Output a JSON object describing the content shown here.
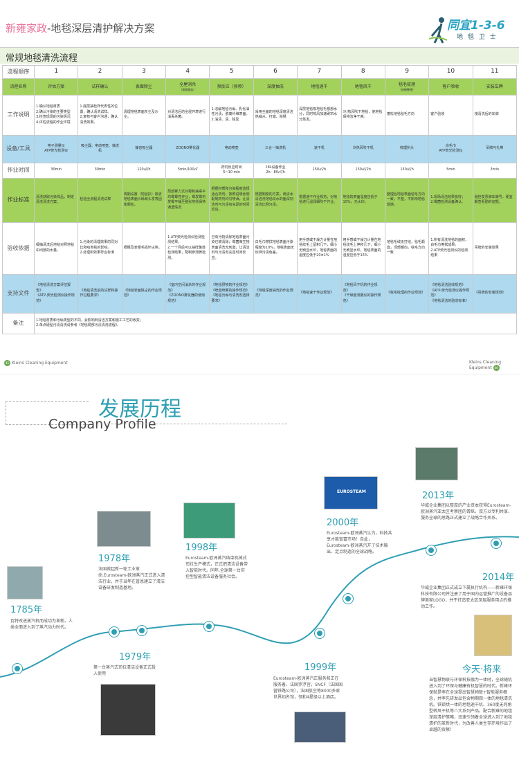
{
  "header": {
    "brand": "新雍家政",
    "title": "-地毯深层清护解决方案",
    "logo_main": "同宜1-3-6",
    "logo_sub": "地 毯 卫 士"
  },
  "section_title": "常规地毯清洗流程",
  "table": {
    "row_heads": [
      "流程顺序",
      "流程名称",
      "工作说明",
      "设备/工具",
      "作业时间",
      "作业标准",
      "验收依据",
      "支持文件",
      "备注"
    ],
    "numbers": [
      "1",
      "2",
      "3",
      "4",
      "5",
      "6",
      "7",
      "8",
      "9",
      "10",
      "11"
    ],
    "names": [
      "评估方案",
      "试样确认",
      "表面除尘",
      "全屋消杀",
      "预反应（预喷）",
      "深度抽洗",
      "地毯速干",
      "地毯风干",
      "毯毛梳理",
      "客户验收",
      "安装车牌"
    ],
    "name_subs": [
      "",
      "",
      "",
      "（地毯服务）",
      "",
      "",
      "",
      "",
      "（机械整理）",
      "",
      ""
    ],
    "desc": [
      "1.确认地毯材质\n2.确认污染的主要类型\n3.检查现场的污染情况\n4.评估流程的作业环境",
      "1.底层抽检样代表性的位置，确认清洗试样。\n2.复核与客户沟通，确认清洗效果。",
      "清理地毯表面灰尘及沙尘。",
      "对清洁后的全屋环境进行消毒杀菌。",
      "1.溶解地毯污垢、乳化油性污渍，脱离纤维表面。\n2.油渍、渍、除臭",
      "采用全面的地毯深度清洁热抽水、打蜡、除锈",
      "深层地毯吸地毯毛根部水分，同时热风加速刷帘水分蒸发。",
      "冷/热风吹干地毯，使地毯保持洁净干爽。",
      "蓬松地毯毯毛方向",
      "客户验收",
      "接清洗后的车牌"
    ],
    "tools": [
      "电子测量仪\nATP荧光检测仪",
      "吸尘器、电动喷壶、抽洗机",
      "静音吸尘器",
      "ZOONO雾化器",
      "电动喷壶",
      "三合一抽洗机",
      "速干机",
      "冷热风吹干机",
      "梳理扒头",
      "白毛巾\nATP荧光检测仪",
      "吊牌与扎带"
    ],
    "time": [
      "30min",
      "30min",
      "120㎡/h",
      "5min/100㎡",
      "药剂反应时间\n5~10 min",
      "18L设备作业\n2h：80㎡/h",
      "150㎡/h",
      "150㎡/2h",
      "150㎡/h",
      "5min",
      "3min"
    ],
    "std": [
      "清洗获取污染样品，制定清洗清洗方案。",
      "检验全流程清洗试样",
      "周期设置（地毯扒）除去地毯表面沙砾和头发等固体颗粒。",
      "局部雾力式对霉和病毒平均霉霉性作业，霉发霉剂发霉平铺至整张地毯保持通透情况",
      "根据材质和污染程度选择适合药剂，按照说明比例配制药剂均匀喷洒，让清洁剂与污渍有充足的时间反应。",
      "根据制度的方案，用清水清洁洗地毯纹水的面深刻清洁比例污渍。",
      "根据速干作业规范，对地毯进行湿润细吹干作业。",
      "地毯的表面湿度应低于15%，无水印。",
      "整理后地毯表面毯毛方向一致，平整，不影响地毯观感。",
      "1.现场清洁效果良好；\n2.霉菌检测设备确认。",
      "悬挂发票牌车牌号，便宜期查看勤的证据。"
    ],
    "acc": [
      "细抽清洗后地毯对照地毯中间部的水量。",
      "1.污染的清理效果的同对比和吸地毯的影响。\n2.处理和效果符合标准",
      "细粗及表粗毛损坏尘埃。",
      "1.ATP荧光检测仪检测检测结果。\n2.一个月后可以抽样菌落检测结果，配制参测微检测。",
      "已有污物清除地毯表面污染已被清除；霉菌微生物表面清洗无刺激，让清洁剂与污渍有充足时间反应。",
      "白毛巾擦拭地毯表面污染程度为10%，地毯表面无标准污渍色差。",
      "用手感或干燥力计量在地毯纹毛上留积几下，细小无刷显水印，地毯表面的湿度应低于20±1%",
      "用手感或干燥力计量在地毯纹毛上停积几下，细小无刷显水印，地毯表面的湿度应低于15%",
      "地毯毛绒无打结，毯毛顺直，顶部朝向，毯毛方向一致",
      "1.所有清洗地毯的面积，白毛巾擦拭成果。\n2.ATP荧光检测仪的检测结果",
      "吊牌的安装效果"
    ],
    "docs": [
      "《地毯清洗方案评估报告》\n《ATP-荧光检测仪操作规范》",
      "《地毯清洗前的试样和操作过程要求》",
      "《地毯表面除尘的作业规范》",
      "《室内空间消杀的作业规范》\n《ZOONO雾化器的使用规范》",
      "《地毯预喷的作业规范》\n《喷壶喷雾的操作规范》\n《地毯污垢与清洗剂选择要求》",
      "《地毯深度抽洗的作业规范》",
      "《地毯速干作业规范》",
      "《地毯风干机的作业规范》\n《干燥度测量仪的操作规范》",
      "《毯毛梳理的作业规范》",
      "《地毯清洁验收规范》\n《ATP-荧光检测仪操作规范》\n《地毯清洁的验收标准》",
      "《吊牌的安装规范》"
    ],
    "notes": [
      "1.地毯材质和污垢类型的不同，会影响到清洁方案和施工工艺的改变；",
      "2.单点硬型污渍清洗请参考《地毯局部污渍清洗流程》。"
    ]
  },
  "footer": {
    "left_page": "45",
    "left_label": "Kleins Cleaning Equipment",
    "right_label": "Kleins Cleaning Equipment",
    "right_page": "46"
  },
  "profile": {
    "title_cn": "发展历程",
    "title_en": "Company Profile"
  },
  "timeline": [
    {
      "year": "1785年",
      "text": "瓦特改进蒸汽机而成功为革新。人类全面进入到了蒸汽动力时代。"
    },
    {
      "year": "1978年",
      "text": "法国掀起新一轮工业革命,Eurosteam-欧洲蒸汽正式进入清洁行业，并于当年在普恩建立了清洁设备研发制造基地。"
    },
    {
      "year": "1979年",
      "text": "第一台蒸汽式司拉清洁设备正式投入使用"
    },
    {
      "year": "1998年",
      "text": "Eurosteam-欧洲蒸汽结束机械式司拉生产模式，正式把清洁设备带入智能时代。同年,全球第一台实控型智能清洁设备服务社会。"
    },
    {
      "year": "1999年",
      "text": "Eurosteam-欧洲蒸汽正服务和正在服务着，法国罗浮宫，SNCF（法国国营铁路公司），法国航空等8000多家世界知名馆，领和4星级以上酒店。"
    },
    {
      "year": "2000年",
      "text": "Eurosteam-欧洲蒸汽认为，科技共享才能智富市场！自此，Eurosteam-欧洲蒸汽开了技术输出、定点制造的全球战略。"
    },
    {
      "year": "2013年",
      "text": "华威企业集团以整厚的产业资本获得Eurosteam-欧洲蒸汽亚太区考察团的青睐，双方以专利共享、服务全球的思路正式建立了战略合作关系。"
    },
    {
      "year": "2014年",
      "text": "华威企业集团正式成立下属执行机构——新雍环保科技有限公司并注册了用于国内运营推广的设备品牌美家LOGO，并于打造亚太区深层服务用点的推动工作。"
    },
    {
      "year": "今天·将来",
      "text": "当智慧物联与环保科技融为一体时，全球随机进入到了环保与健康有机智慧的时代。新雍环保就是率在全球提出智慧物联+智能服务概念，并率先研发出包含物期观一体的地毯清洗机。铁锁烘一体的地毯速干机、360度无死角型转风干机等八大系列产品。配合新雍的地毯深层清护策略，迅速引领着全球进入到了地毯清护的革新时代，为改善人类生存环境作出了卓越的贡献！"
    }
  ],
  "photo_labels": {
    "eurosteam": "EUROSTEAM"
  },
  "colors": {
    "green": "#a2d25c",
    "blue": "#aed9ef",
    "teal": "#2e9fb3",
    "pink": "#e8739a"
  }
}
